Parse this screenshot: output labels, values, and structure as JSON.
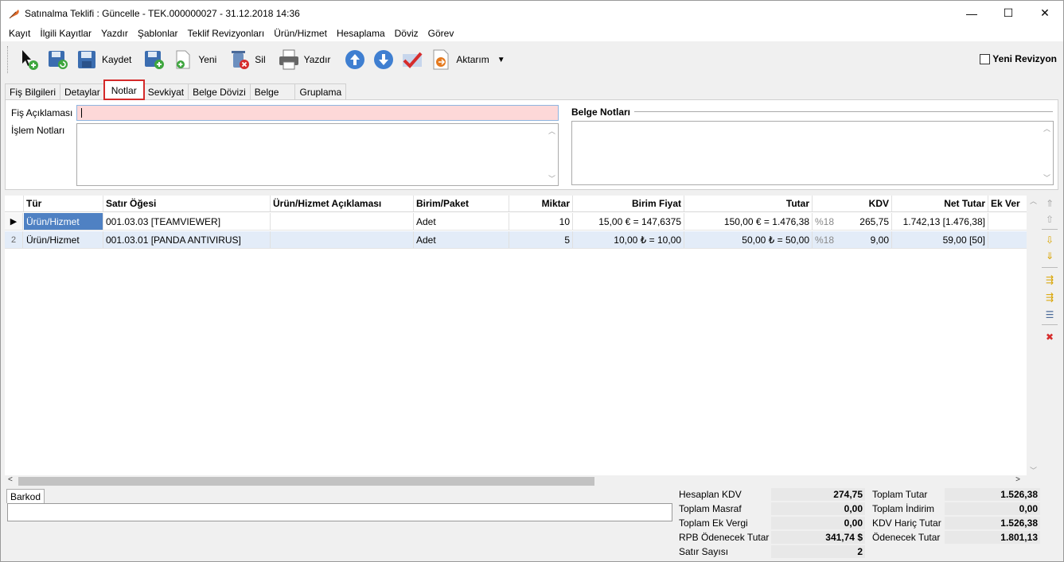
{
  "window": {
    "title": "Satınalma Teklifi : Güncelle - TEK.000000027 - 31.12.2018 14:36",
    "minimize": "—",
    "maximize": "☐",
    "close": "✕"
  },
  "menu": [
    "Kayıt",
    "İlgili Kayıtlar",
    "Yazdır",
    "Şablonlar",
    "Teklif Revizyonları",
    "Ürün/Hizmet",
    "Hesaplama",
    "Döviz",
    "Görev"
  ],
  "toolbar": {
    "kaydet": "Kaydet",
    "yeni": "Yeni",
    "sil": "Sil",
    "yazdir": "Yazdır",
    "aktarim": "Aktarım",
    "yeni_revizyon": "Yeni Revizyon",
    "yeni_revizyon_checked": false
  },
  "tabs": [
    "Fiş Bilgileri",
    "Detaylar",
    "Notlar",
    "Sevkiyat",
    "Belge Dövizi",
    "Belge",
    "Gruplama"
  ],
  "active_tab": "Notlar",
  "notes": {
    "fis_aciklamasi_label": "Fiş Açıklaması",
    "fis_aciklamasi_value": "",
    "islem_notlari_label": "İşlem Notları",
    "islem_notlari_value": "",
    "belge_notlari_label": "Belge Notları",
    "belge_notlari_value": ""
  },
  "grid": {
    "columns": [
      "Tür",
      "Satır Öğesi",
      "Ürün/Hizmet Açıklaması",
      "Birim/Paket",
      "Miktar",
      "Birim Fiyat",
      "Tutar",
      "KDV",
      "Net Tutar",
      "Ek Ver"
    ],
    "rows": [
      {
        "indicator": "▶",
        "tur": "Ürün/Hizmet",
        "satir": "001.03.03 [TEAMVIEWER]",
        "aciklama": "",
        "birim": "Adet",
        "miktar": "10",
        "birim_fiyat": "15,00 € = 147,6375",
        "tutar": "150,00 € = 1.476,38",
        "kdv_oran": "%18",
        "kdv": "265,75",
        "net_tutar": "1.742,13 [1.476,38]",
        "ek": ""
      },
      {
        "indicator": "2",
        "tur": "Ürün/Hizmet",
        "satir": "001.03.01 [PANDA ANTIVIRUS]",
        "aciklama": "",
        "birim": "Adet",
        "miktar": "5",
        "birim_fiyat": "10,00 ₺ = 10,00",
        "tutar": "50,00 ₺ = 50,00",
        "kdv_oran": "%18",
        "kdv": "9,00",
        "net_tutar": "59,00 [50]",
        "ek": ""
      }
    ]
  },
  "barkod": {
    "label": "Barkod",
    "value": ""
  },
  "totals": {
    "left": [
      {
        "label": "Hesaplan KDV",
        "value": "274,75"
      },
      {
        "label": "Toplam Masraf",
        "value": "0,00"
      },
      {
        "label": "Toplam Ek Vergi",
        "value": "0,00"
      },
      {
        "label": "RPB Ödenecek Tutar",
        "value": "341,74 $"
      },
      {
        "label": "Satır Sayısı",
        "value": "2"
      }
    ],
    "right": [
      {
        "label": "Toplam Tutar",
        "value": "1.526,38"
      },
      {
        "label": "Toplam İndirim",
        "value": "0,00"
      },
      {
        "label": "KDV Hariç Tutar",
        "value": "1.526,38"
      },
      {
        "label": "Ödenecek Tutar",
        "value": "1.801,13"
      }
    ]
  }
}
